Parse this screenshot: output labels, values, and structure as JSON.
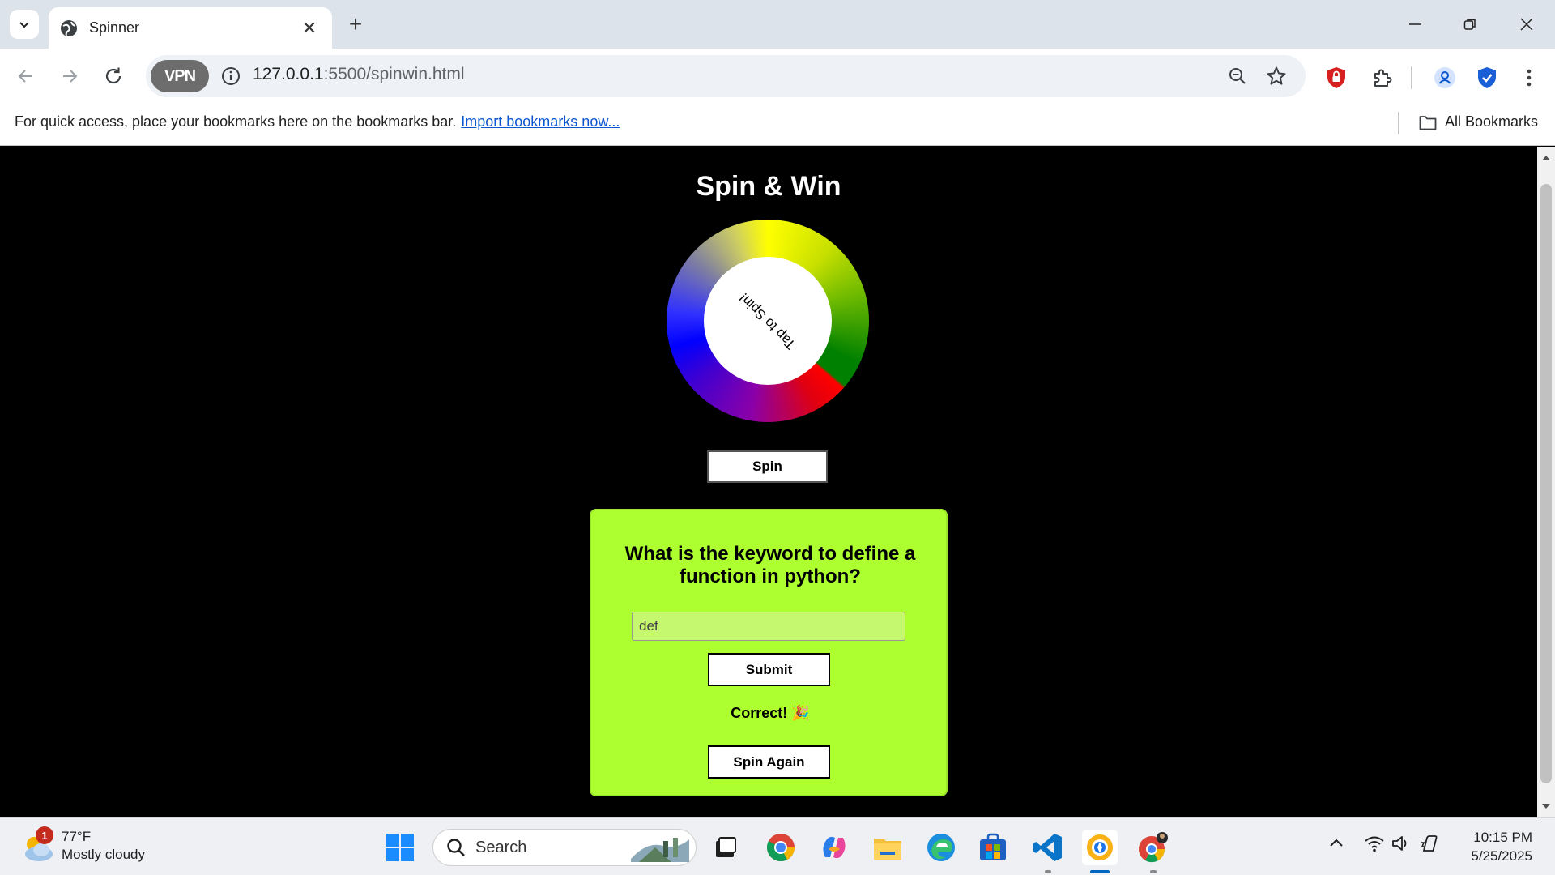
{
  "browser": {
    "tab_title": "Spinner",
    "url_host": "127.0.0.1",
    "url_path": ":5500/spinwin.html",
    "vpn_label": "VPN",
    "bookmarks_hint": "For quick access, place your bookmarks here on the bookmarks bar.",
    "import_link": "Import bookmarks now...",
    "all_bookmarks": "All Bookmarks"
  },
  "app": {
    "title": "Spin & Win",
    "wheel_label": "Tap to Spin!",
    "spin_button": "Spin",
    "question": "What is the keyword to define a function in python?",
    "answer_value": "def",
    "submit_button": "Submit",
    "feedback": "Correct! 🎉",
    "spin_again_button": "Spin Again"
  },
  "taskbar": {
    "weather_temp": "77°F",
    "weather_desc": "Mostly cloudy",
    "weather_badge": "1",
    "search_placeholder": "Search",
    "time": "10:15 PM",
    "date": "5/25/2025"
  },
  "colors": {
    "quiz_bg": "#adff2f",
    "page_bg": "#000000",
    "accent_link": "#0b57d0"
  }
}
